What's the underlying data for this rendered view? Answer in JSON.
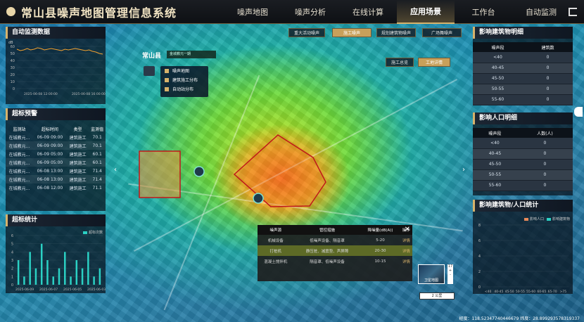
{
  "header": {
    "title": "常山县噪声地图管理信息系统",
    "nav": [
      "噪声地图",
      "噪声分析",
      "在线计算",
      "应用场景",
      "工作台",
      "自动监测"
    ],
    "active_nav": 3
  },
  "map": {
    "region_label": "常山县",
    "search_placeholder": "金城教元一期",
    "scene_buttons": [
      "重大活动噪声",
      "施工噪声",
      "规划建筑物噪声",
      "广场舞噪声"
    ],
    "active_scene": 1,
    "view_buttons": [
      "施工总览",
      "工地详情"
    ],
    "active_view": 1,
    "layers": [
      "噪声地图",
      "建筑施工分布",
      "自动站分布"
    ],
    "scale_label": "2 公里",
    "zoom": "17",
    "minimap_label": "卫星地图",
    "coords_text": "经度：118.52347740446679     纬度：28.899293578319337"
  },
  "monitor": {
    "title": "自动监测数据",
    "y_label": "dB",
    "y_ticks": [
      "60",
      "50",
      "40",
      "30",
      "20",
      "10",
      "0"
    ],
    "x_ticks": [
      "2025-06-08 12:00:00",
      "2025-06-08 16:00:00"
    ],
    "line_values": [
      56,
      54,
      55,
      57,
      55,
      56,
      58,
      57,
      55,
      56,
      57,
      56,
      55,
      54,
      56,
      55,
      56,
      57,
      56,
      55,
      54,
      55,
      53,
      52,
      50,
      49
    ]
  },
  "alarms": {
    "title": "超标预警",
    "headers": [
      "监测站",
      "超标时间",
      "类型",
      "监测值"
    ],
    "rows": [
      [
        "在城教元...",
        "06-09 09:00",
        "建筑施工",
        "70.1"
      ],
      [
        "在城教元...",
        "06-09 09:00",
        "建筑施工",
        "70.1"
      ],
      [
        "在城教元...",
        "06-09 05:00",
        "建筑施工",
        "60.1"
      ],
      [
        "在城教元...",
        "06-09 05:00",
        "建筑施工",
        "60.1"
      ],
      [
        "在城教元...",
        "06-08 13:00",
        "建筑施工",
        "71.4"
      ],
      [
        "在城教元...",
        "06-08 13:00",
        "建筑施工",
        "71.4"
      ],
      [
        "在城教元...",
        "06-08 12:00",
        "建筑施工",
        "71.1"
      ]
    ]
  },
  "stats": {
    "title": "超标统计",
    "legend": "超标次数",
    "y_ticks": [
      "6",
      "5",
      "4",
      "3",
      "2",
      "1",
      "0"
    ],
    "x_ticks": [
      "2025-06-09",
      "2025-06-07",
      "2025-06-05",
      "2025-06-03"
    ],
    "values": [
      3,
      1,
      4,
      2,
      5,
      3,
      1,
      2,
      4,
      1,
      3,
      2,
      4,
      1,
      2
    ]
  },
  "buildings": {
    "title": "影响建筑物明细",
    "headers": [
      "噪声段",
      "建筑数"
    ],
    "rows": [
      [
        "<40",
        "0"
      ],
      [
        "40-45",
        "0"
      ],
      [
        "45-50",
        "0"
      ],
      [
        "50-55",
        "0"
      ],
      [
        "55-60",
        "0"
      ]
    ]
  },
  "population": {
    "title": "影响人口明细",
    "headers": [
      "噪声段",
      "人数(人)"
    ],
    "rows": [
      [
        "<40",
        "0"
      ],
      [
        "40-45",
        "0"
      ],
      [
        "45-50",
        "0"
      ],
      [
        "50-55",
        "0"
      ],
      [
        "55-60",
        "0"
      ]
    ]
  },
  "bp_stats": {
    "title": "影响建筑物/人口统计",
    "legend": [
      "影响人口",
      "影响建筑物"
    ],
    "x_ticks": [
      "<40",
      "40-45",
      "45-50",
      "50-55",
      "55-60",
      "60-65",
      "65-70",
      ">75"
    ],
    "y_left": [
      "8",
      "6",
      "4",
      "2",
      "0"
    ]
  },
  "popup": {
    "headers": [
      "噪声源",
      "管控措施",
      "降噪量(dB(A))",
      "操作"
    ],
    "rows": [
      [
        "机械设备",
        "低噪声设备、隔音罩",
        "5-20",
        "详情"
      ],
      [
        "打桩机",
        "静压桩、减震垫、声屏障",
        "20-30",
        "详情"
      ],
      [
        "混凝土搅拌机",
        "隔音罩、低噪声设备",
        "10-15",
        "详情"
      ]
    ]
  }
}
